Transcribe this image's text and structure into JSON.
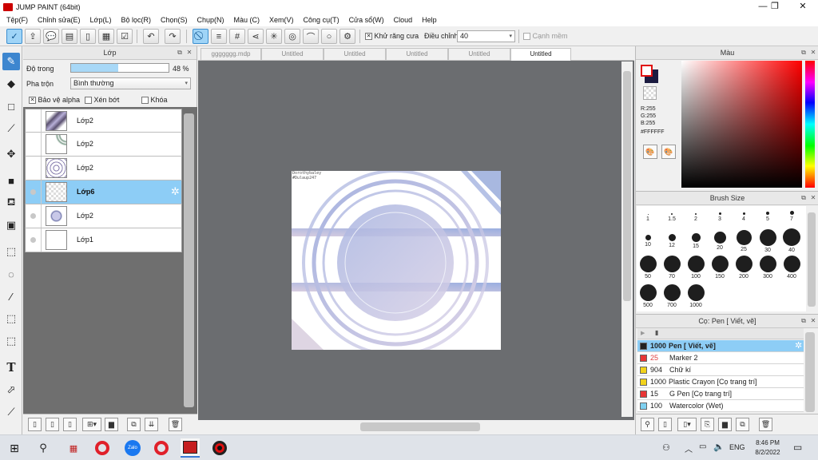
{
  "app": {
    "title": "JUMP PAINT (64bit)"
  },
  "window_controls": {
    "minimize": "—",
    "maximize": "❐",
    "close": "✕"
  },
  "menu": [
    "Tệp(F)",
    "Chỉnh sửa(E)",
    "Lớp(L)",
    "Bộ lọc(R)",
    "Chọn(S)",
    "Chụp(N)",
    "Màu (C)",
    "Xem(V)",
    "Công cụ(T)",
    "Cửa sổ(W)",
    "Cloud",
    "Help"
  ],
  "toolbar": {
    "antialias_label": "Khử răng cưa",
    "antialias_checked": true,
    "adjust_label": "Điều chỉnh",
    "adjust_value": "40",
    "sharp_edge_label": "Cạnh mềm",
    "sharp_edge_checked": false
  },
  "layer_panel": {
    "title": "Lớp",
    "opacity_label": "Độ trong",
    "opacity_value": "48 %",
    "opacity": 0.48,
    "blend_label": "Pha trộn",
    "blend_value": "Bình thường",
    "protect_alpha_label": "Bảo vệ alpha",
    "protect_alpha_checked": true,
    "clip_label": "Xén bớt",
    "clip_checked": false,
    "lock_label": "Khóa",
    "lock_checked": false,
    "layers": [
      {
        "name": "Lớp2",
        "selected": false,
        "visible_dot": false
      },
      {
        "name": "Lớp2",
        "selected": false,
        "visible_dot": false
      },
      {
        "name": "Lớp2",
        "selected": false,
        "visible_dot": false
      },
      {
        "name": "Lớp6",
        "selected": true,
        "visible_dot": true
      },
      {
        "name": "Lớp2",
        "selected": false,
        "visible_dot": true
      },
      {
        "name": "Lớp1",
        "selected": false,
        "visible_dot": true
      }
    ]
  },
  "tabs": [
    {
      "label": "ggggggg.mdp",
      "active": false
    },
    {
      "label": "Untitled",
      "active": false
    },
    {
      "label": "Untitled",
      "active": false
    },
    {
      "label": "Untitled",
      "active": false
    },
    {
      "label": "Untitled",
      "active": false
    },
    {
      "label": "Untitled",
      "active": true
    }
  ],
  "canvas": {
    "watermark_line1": "Dorothybaley",
    "watermark_line2": "#Dulaup247"
  },
  "color_panel": {
    "title": "Màu",
    "r": "R:255",
    "g": "G:255",
    "b": "B:255",
    "hex": "#FFFFFF",
    "accent": "#ff0000"
  },
  "brush_size_panel": {
    "title": "Brush Size",
    "sizes": [
      "1",
      "1.5",
      "2",
      "3",
      "4",
      "5",
      "7",
      "10",
      "12",
      "15",
      "20",
      "25",
      "30",
      "40",
      "50",
      "70",
      "100",
      "150",
      "200",
      "300",
      "400",
      "500",
      "700",
      "1000"
    ]
  },
  "brush_panel": {
    "title": "Cọ: Pen [ Viết, vẽ]",
    "brushes": [
      {
        "size": "1000",
        "name": "Pen [ Viết, vẽ]",
        "color": "#222222",
        "selected": true
      },
      {
        "size": "25",
        "name": "Marker 2",
        "color": "#e83535",
        "selected": false
      },
      {
        "size": "904",
        "name": "Chữ kí",
        "color": "#f2d21b",
        "selected": false
      },
      {
        "size": "1000",
        "name": "Plastic Crayon [Cọ trang trí]",
        "color": "#f2d21b",
        "selected": false
      },
      {
        "size": "15",
        "name": "G Pen [Cọ trang trí]",
        "color": "#e83535",
        "selected": false
      },
      {
        "size": "100",
        "name": "Watercolor (Wet)",
        "color": "#7fd0f0",
        "selected": false
      }
    ]
  },
  "taskbar": {
    "time": "8:46 PM",
    "date": "8/2/2022",
    "language": "ENG"
  }
}
